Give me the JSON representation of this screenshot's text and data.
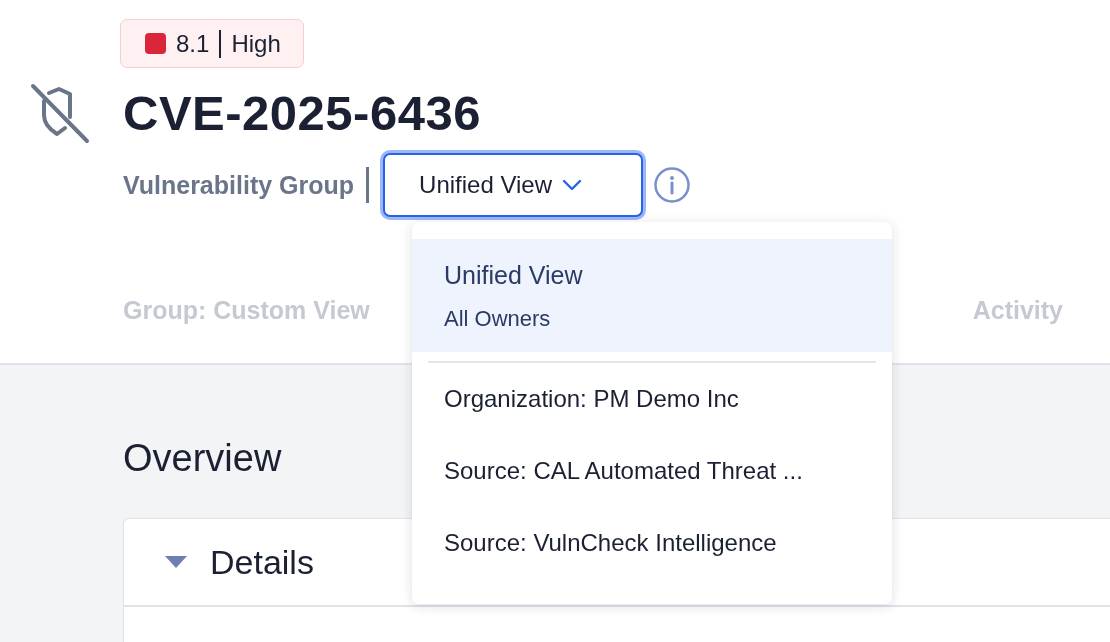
{
  "severity": {
    "score": "8.1",
    "label": "High",
    "color": "#d9263a"
  },
  "title": "CVE-2025-6436",
  "subtitle": "Vulnerability Group",
  "view_select": {
    "value": "Unified View",
    "expanded": true
  },
  "dropdown_options": [
    {
      "kind": "group",
      "label": "Unified View",
      "sublabel": "All Owners",
      "selected": true
    },
    {
      "kind": "item",
      "label": "Organization: PM Demo Inc",
      "selected": false
    },
    {
      "kind": "item",
      "label": "Source: CAL Automated Threat ...",
      "selected": false
    },
    {
      "kind": "item",
      "label": "Source: VulnCheck Intelligence",
      "selected": false
    }
  ],
  "tabs": [
    {
      "label": "Group: Custom View",
      "selected": false
    },
    {
      "label": "Activity",
      "selected": false
    }
  ],
  "section_title": "Overview",
  "details": {
    "title": "Details",
    "expanded": true
  }
}
